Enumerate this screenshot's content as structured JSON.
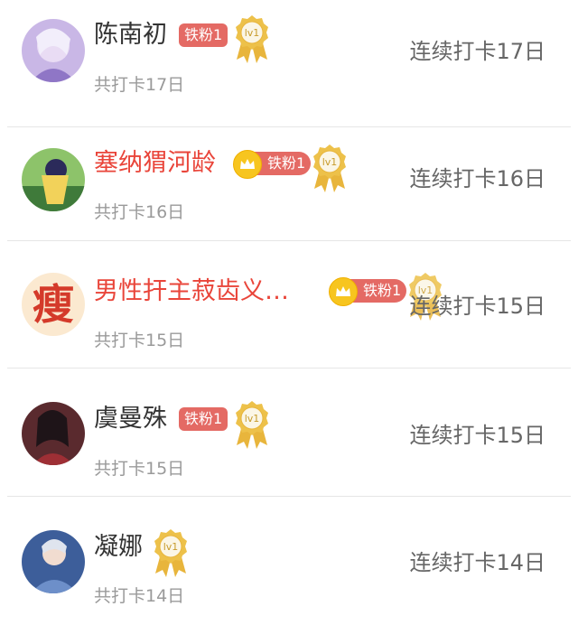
{
  "users": [
    {
      "name": "陈南初",
      "fan_badge": "铁粉1",
      "level": "lv1",
      "total": "共打卡17日",
      "streak": "连续打卡17日",
      "vip": false
    },
    {
      "name": "塞纳猬河龄",
      "fan_badge": "铁粉1",
      "level": "lv1",
      "total": "共打卡16日",
      "streak": "连续打卡16日",
      "vip": true
    },
    {
      "name": "男性扞主菽齿义…",
      "fan_badge": "铁粉1",
      "level": "lv1",
      "total": "共打卡15日",
      "streak": "连续打卡15日",
      "vip": true
    },
    {
      "name": "虞曼殊",
      "fan_badge": "铁粉1",
      "level": "lv1",
      "total": "共打卡15日",
      "streak": "连续打卡15日",
      "vip": false
    },
    {
      "name": "凝娜",
      "level": "lv1",
      "total": "共打卡14日",
      "streak": "连续打卡14日",
      "vip": false
    }
  ],
  "avatar_character": "瘦",
  "colors": {
    "vip_name": "#e9453a",
    "fan_badge_bg": "#e46a64",
    "medal_gold": "#e8b53c",
    "crown_gold": "#f7c51f"
  }
}
